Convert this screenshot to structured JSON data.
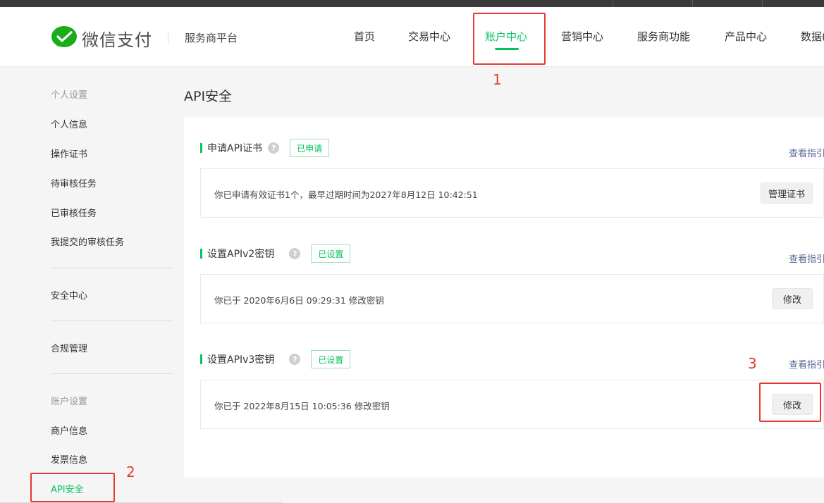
{
  "brand": {
    "logo_text": "微信支付",
    "platform": "服务商平台",
    "accent_color": "#07c160"
  },
  "nav": {
    "items": [
      {
        "label": "首页"
      },
      {
        "label": "交易中心"
      },
      {
        "label": "账户中心",
        "active": true
      },
      {
        "label": "营销中心"
      },
      {
        "label": "服务商功能"
      },
      {
        "label": "产品中心"
      },
      {
        "label": "数据("
      }
    ]
  },
  "sidebar": {
    "group_personal": "个人设置",
    "personal_items": [
      "个人信息",
      "操作证书",
      "待审核任务",
      "已审核任务",
      "我提交的审核任务"
    ],
    "security_center": "安全中心",
    "compliance": "合规管理",
    "group_account": "账户设置",
    "account_items": [
      "商户信息",
      "发票信息",
      "API安全"
    ],
    "active_item": "API安全"
  },
  "main": {
    "title": "API安全",
    "sections": [
      {
        "title": "申请API证书",
        "help_icon": "question-circle-icon",
        "status": "已申请",
        "guide": "查看指引",
        "info": "你已申请有效证书1个，最早过期时间为2027年8月12日 10:42:51",
        "button": "管理证书"
      },
      {
        "title": "设置APIv2密钥",
        "help_icon": "question-circle-icon",
        "status": "已设置",
        "guide": "查看指引",
        "info": "你已于 2020年6月6日 09:29:31 修改密钥",
        "button": "修改"
      },
      {
        "title": "设置APIv3密钥",
        "help_icon": "question-circle-icon",
        "status": "已设置",
        "guide": "查看指引",
        "info": "你已于 2022年8月15日 10:05:36 修改密钥",
        "button": "修改"
      }
    ]
  },
  "annotations": {
    "n1": "1",
    "n2": "2",
    "n3": "3",
    "color": "#e53935"
  }
}
